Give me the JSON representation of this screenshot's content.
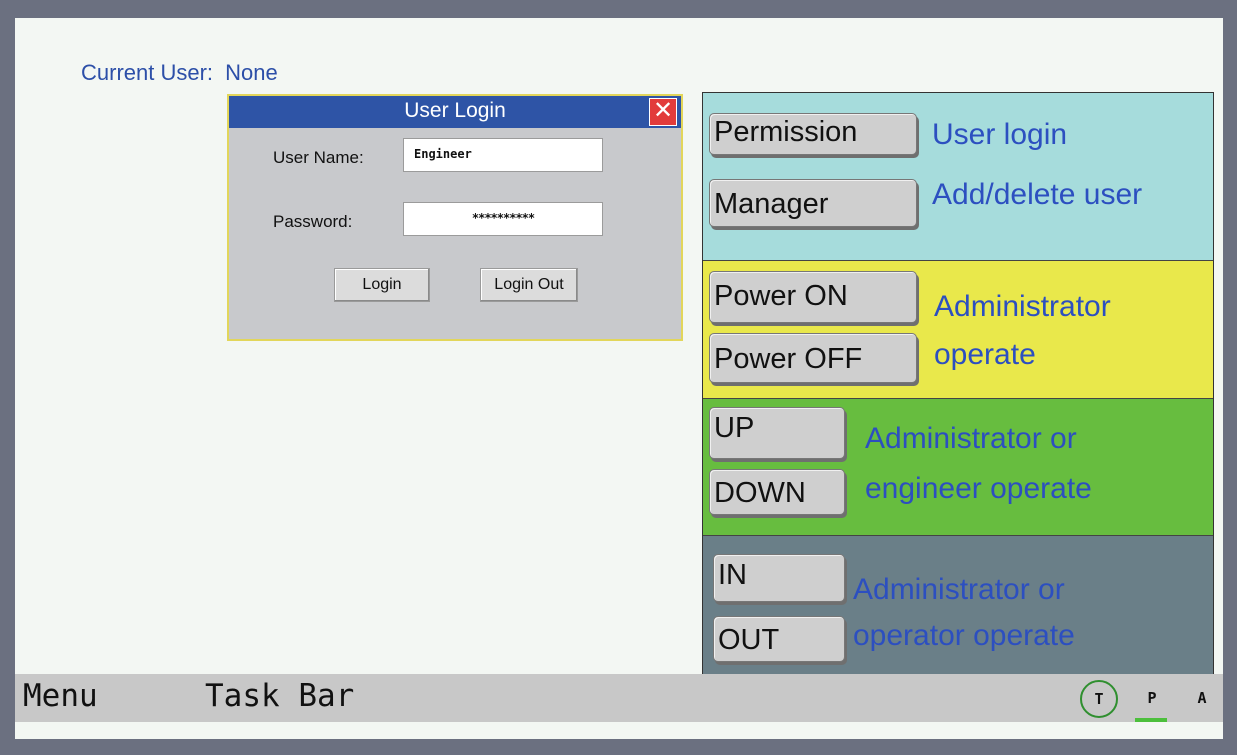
{
  "current_user": {
    "label": "Current User:",
    "value": "None"
  },
  "login_dialog": {
    "title": "User Login",
    "close_glyph": "✕",
    "username_label": "User Name:",
    "username_value": "Engineer",
    "password_label": "Password:",
    "password_value": "**********",
    "login_button": "Login",
    "logout_button": "Login Out"
  },
  "panel": {
    "sections": [
      {
        "color": "#a6dcdc",
        "buttons": [
          "Permission",
          "Manager"
        ],
        "description_lines": [
          "User login",
          "Add/delete user"
        ]
      },
      {
        "color": "#e9e84b",
        "buttons": [
          "Power ON",
          "Power OFF"
        ],
        "description_lines": [
          "Administrator",
          "operate"
        ]
      },
      {
        "color": "#67bd3f",
        "buttons": [
          "UP",
          "DOWN"
        ],
        "description_lines": [
          "Administrator or",
          "engineer operate"
        ]
      },
      {
        "color": "#6a7f88",
        "buttons": [
          "IN",
          "OUT"
        ],
        "description_lines": [
          "Administrator or",
          "operator operate"
        ]
      }
    ]
  },
  "taskbar": {
    "menu_label": "Menu",
    "taskbar_label": "Task Bar",
    "indicators": [
      "T",
      "P",
      "A"
    ],
    "active_indicator_color": "#4cbf3c"
  }
}
